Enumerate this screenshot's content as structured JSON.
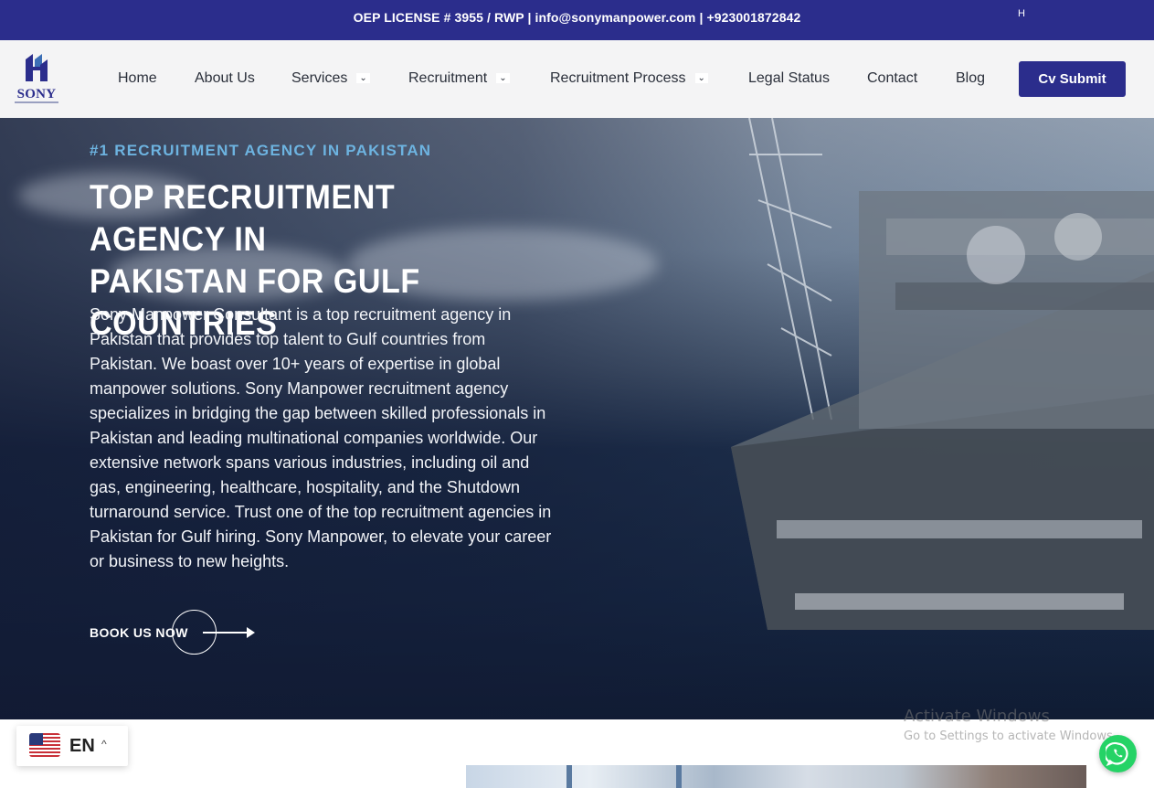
{
  "topbar": {
    "info": "OEP LICENSE # 3955 / RWP | info@sonymanpower.com | +923001872842",
    "stray_glyph": "H"
  },
  "logo": {
    "word": "SONY",
    "icon": "sony-logo-mark"
  },
  "nav": {
    "items": [
      {
        "label": "Home"
      },
      {
        "label": "About Us"
      },
      {
        "label": "Services",
        "has_dropdown": true
      },
      {
        "label": "Recruitment",
        "has_dropdown": true
      },
      {
        "label": "Recruitment Process",
        "has_dropdown": true
      },
      {
        "label": "Legal Status"
      },
      {
        "label": "Contact"
      },
      {
        "label": "Blog"
      }
    ],
    "chevron_glyph": "⌄",
    "cta": "Cv Submit"
  },
  "hero": {
    "kicker": "#1 RECRUITMENT AGENCY IN PAKISTAN",
    "headline_line1": "TOP RECRUITMENT AGENCY IN",
    "headline_line2": "PAKISTAN FOR GULF COUNTRIES",
    "body": "Sony Manpower Consultant is a top recruitment agency in Pakistan that provides top talent to Gulf countries from Pakistan. We boast over 10+ years of expertise in global manpower solutions. Sony Manpower recruitment agency specializes in bridging the gap between skilled professionals in Pakistan and leading multinational companies worldwide. Our extensive network spans various industries, including oil and gas, engineering, healthcare, hospitality, and the Shutdown turnaround service. Trust one of the top recruitment agencies in Pakistan for Gulf hiring. Sony Manpower, to elevate your career or business to new heights.",
    "cta": "BOOK US NOW"
  },
  "watermark": {
    "line1": "Activate Windows",
    "line2": "Go to Settings to activate Windows."
  },
  "language": {
    "code": "EN",
    "caret": "^",
    "flag": "us-flag-icon"
  },
  "colors": {
    "brand": "#2b2d8c",
    "kicker": "#6db3e0",
    "whatsapp": "#25d366"
  }
}
